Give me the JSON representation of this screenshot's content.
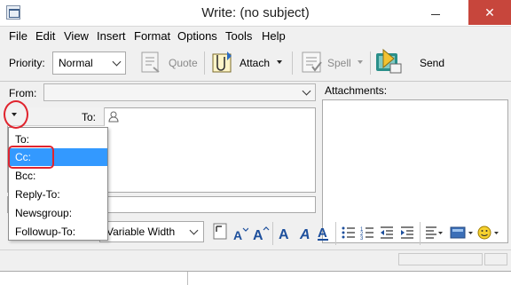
{
  "window": {
    "title": "Write: (no subject)",
    "close_glyph": "✕"
  },
  "menu": [
    "File",
    "Edit",
    "View",
    "Insert",
    "Format",
    "Options",
    "Tools",
    "Help"
  ],
  "toolbar": {
    "priority_label": "Priority:",
    "priority_value": "Normal",
    "quote_label": "Quote",
    "attach_label": "Attach",
    "spell_label": "Spell",
    "send_label": "Send"
  },
  "header": {
    "from_label": "From:",
    "to_label": "To:",
    "attachments_label": "Attachments:"
  },
  "recipient_type_menu": {
    "items": [
      "To:",
      "Cc:",
      "Bcc:",
      "Reply-To:",
      "Newsgroup:",
      "Followup-To:"
    ],
    "selected_index": 1
  },
  "format": {
    "font_value": "Variable Width"
  },
  "colors": {
    "selection": "#3399ff",
    "annotation": "#e0242e",
    "format_icons": "#1d4f9c"
  }
}
